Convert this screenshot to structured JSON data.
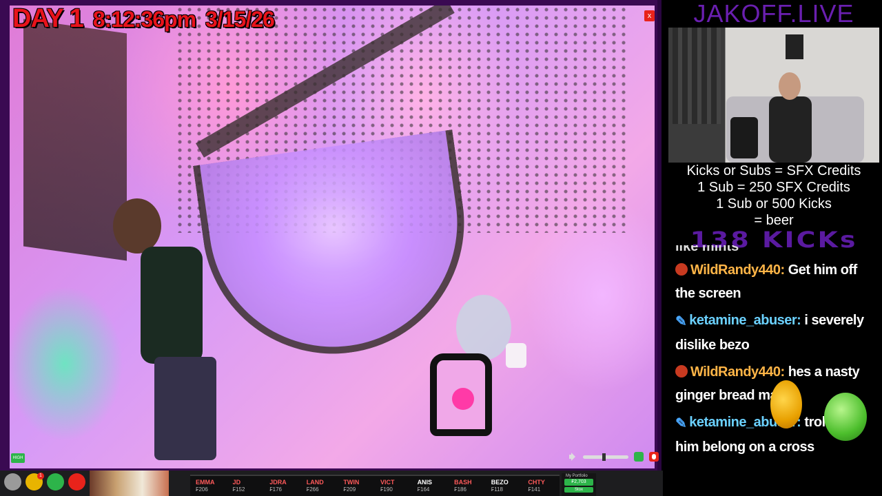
{
  "stream": {
    "day_label": "DAY 1",
    "time": "8:12:36pm",
    "date": "3/15/26",
    "close_label": "x",
    "hd_label": "HIGH"
  },
  "sidebar": {
    "brand": "JAKOFF.LIVE",
    "info_lines": [
      "Kicks or Subs = SFX Credits",
      "1 Sub = 250 SFX Credits",
      "1 Sub or 500 Kicks",
      "= beer"
    ],
    "kicks_counter": "138 KICKs"
  },
  "chat": {
    "cut_text": "like mints",
    "messages": [
      {
        "user": "WildRandy440:",
        "text": "Get him off the screen",
        "badge": "skull-badge-icon"
      },
      {
        "user": "ketamine_abuser:",
        "text": "i severely dislike bezo",
        "badge": "pen-badge-icon"
      },
      {
        "user": "WildRandy440:",
        "text": "hes a nasty ginger bread man",
        "badge": "skull-badge-icon"
      },
      {
        "user": "ketamine_abuser:",
        "text": "trolls like him belong on a cross",
        "badge": "pen-badge-icon"
      }
    ]
  },
  "ticker": [
    {
      "name": "EMMA",
      "price": "₣206"
    },
    {
      "name": "JD",
      "price": "₣152"
    },
    {
      "name": "JDRA",
      "price": "₣176"
    },
    {
      "name": "LAND",
      "price": "₣266"
    },
    {
      "name": "TWIN",
      "price": "₣209"
    },
    {
      "name": "VICT",
      "price": "₣190"
    },
    {
      "name": "ANIS",
      "price": "₣164"
    },
    {
      "name": "BASH",
      "price": "₣186"
    },
    {
      "name": "BEZO",
      "price": "₣118"
    },
    {
      "name": "CHTY",
      "price": "₣141"
    }
  ],
  "portfolio": {
    "label": "My Portfolio",
    "value": "₣2,703",
    "action": "Stox"
  },
  "taskbar": {
    "badge_count": "1",
    "icons": [
      "gear-icon",
      "trophy-icon",
      "battery-icon",
      "mic-off-icon"
    ]
  },
  "colors": {
    "accent_purple": "#6a1fb0",
    "hud_red": "#e8131b",
    "chat_user_orange": "#ffb547",
    "chat_user_blue": "#6bd1ff",
    "ticker_green": "#2db44a"
  }
}
